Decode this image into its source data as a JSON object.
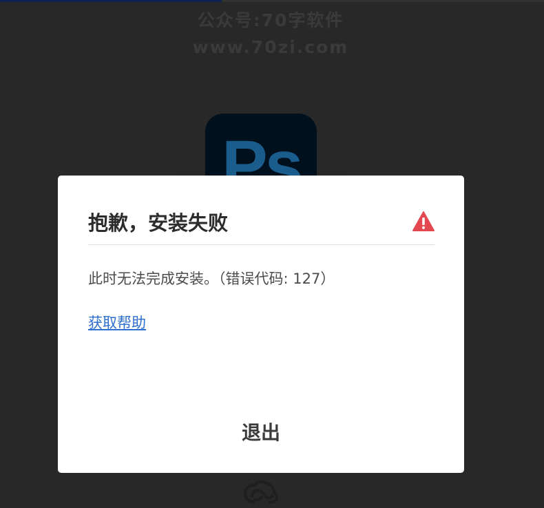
{
  "watermark": {
    "line1": "公众号:70字软件",
    "line2": "www.70zi.com"
  },
  "app_logo": {
    "text": "Ps",
    "name": "photoshop-logo",
    "background": "#001e36",
    "accent": "#31a8ff"
  },
  "dialog": {
    "title": "抱歉，安装失败",
    "message": "此时无法完成安装。（错误代码: 127）",
    "help_link": "获取帮助",
    "exit_label": "退出",
    "alert_icon": "warning-triangle-icon",
    "alert_color": "#e34850",
    "link_color": "#2c6fce"
  },
  "footer": {
    "icon": "creative-cloud-icon"
  }
}
